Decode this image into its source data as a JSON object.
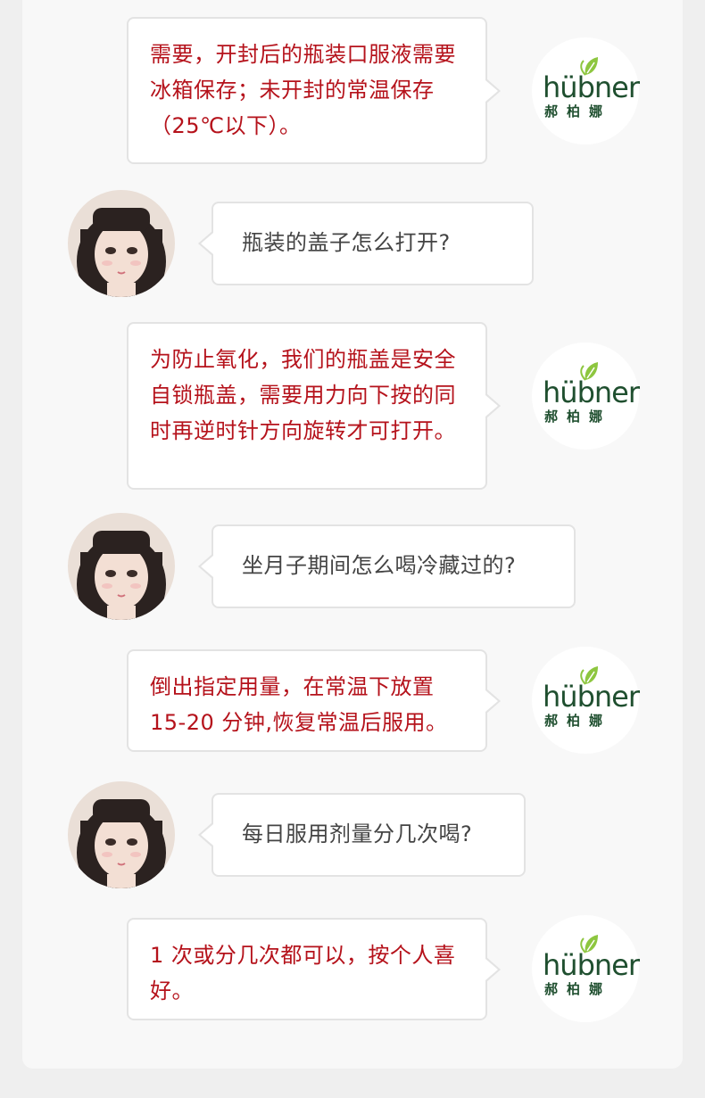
{
  "brand": {
    "wordmark": "hübner",
    "cn": "郝柏娜",
    "colors": {
      "text": "#b5121b",
      "leaf_green": "#8dc63f",
      "logo_dark_green": "#1f4f2f"
    }
  },
  "conversation": [
    {
      "role": "brand",
      "text": "需要，开封后的瓶装口服液需要冰箱保存；未开封的常温保存（25℃以下）。"
    },
    {
      "role": "user",
      "text": "瓶装的盖子怎么打开?"
    },
    {
      "role": "brand",
      "text": "为防止氧化，我们的瓶盖是安全自锁瓶盖，需要用力向下按的同时再逆时针方向旋转才可打开。"
    },
    {
      "role": "user",
      "text": "坐月子期间怎么喝冷藏过的?"
    },
    {
      "role": "brand",
      "text": "倒出指定用量，在常温下放置15-20 分钟,恢复常温后服用。"
    },
    {
      "role": "user",
      "text": "每日服用剂量分几次喝?"
    },
    {
      "role": "brand",
      "text": "1 次或分几次都可以，按个人喜好。"
    }
  ]
}
